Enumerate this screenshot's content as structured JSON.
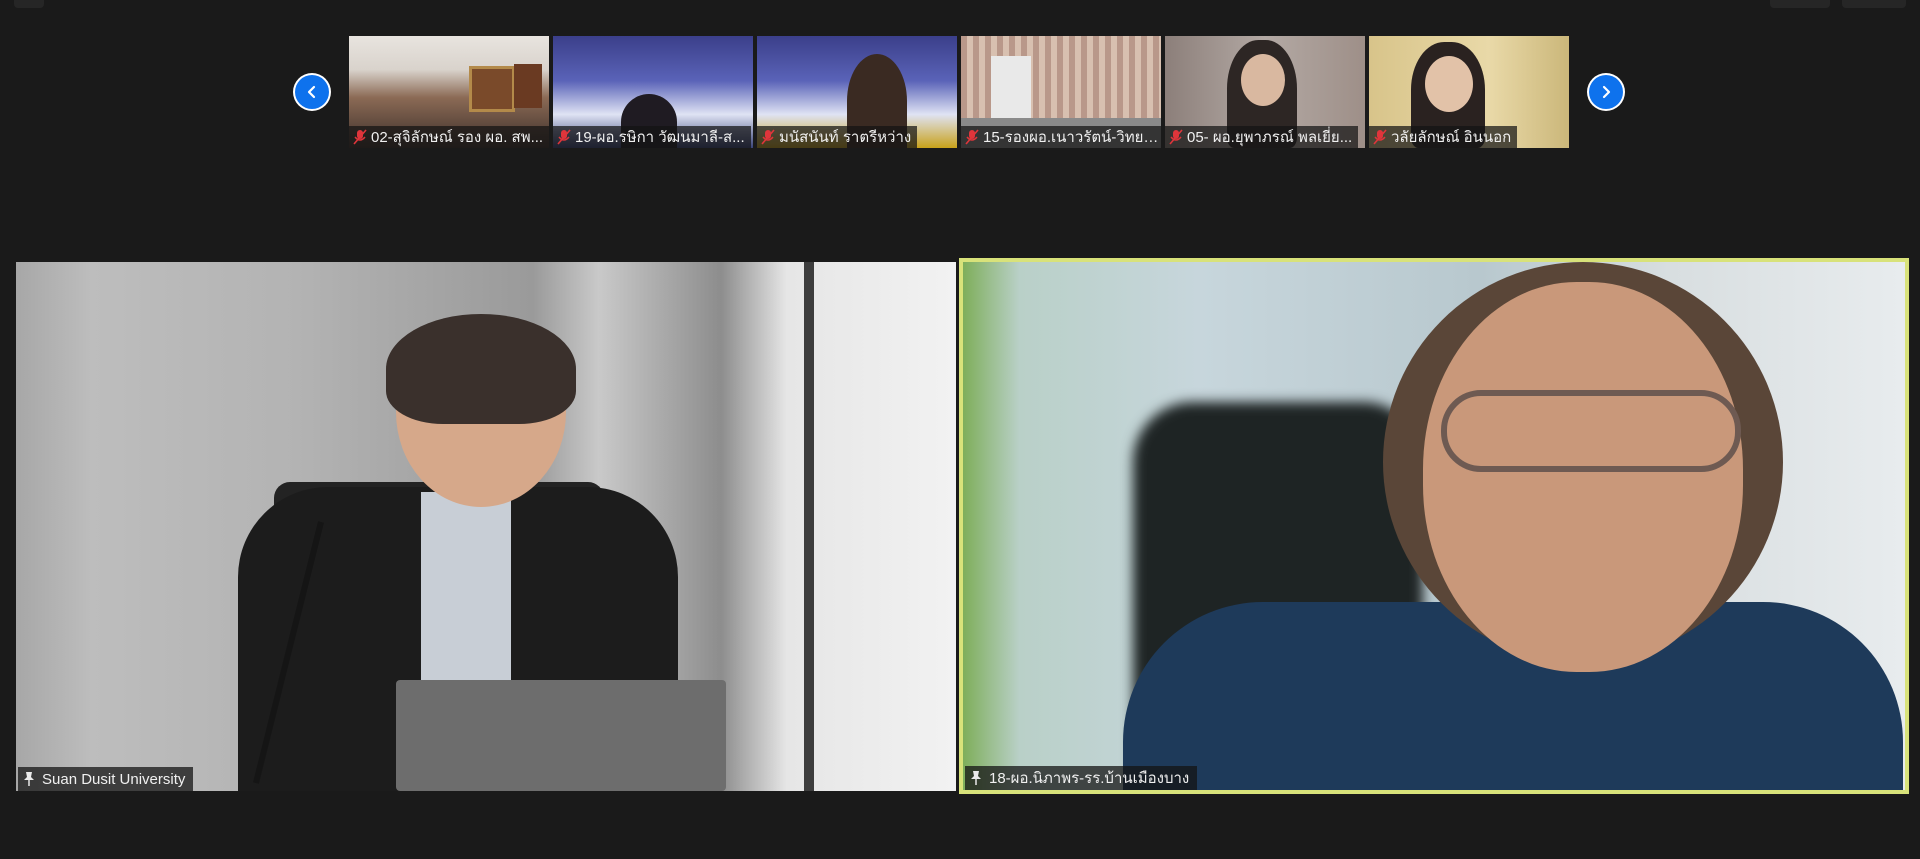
{
  "thumbnails": [
    {
      "label": "02-สุจิลักษณ์ รอง ผอ. สพ..."
    },
    {
      "label": "19-ผอ.รษิกา วัฒนมาลี-ส..."
    },
    {
      "label": "มนัสนันท์ ราตรีหว่าง"
    },
    {
      "label": "15-รองผอ.เนาวรัตน์-วิทยา..."
    },
    {
      "label": "05- ผอ.ยุพาภรณ์  พลเยี่ย..."
    },
    {
      "label": "วลัยลักษณ์ อินนอก"
    }
  ],
  "main_tiles": [
    {
      "label": "Suan Dusit University",
      "active_speaker": false
    },
    {
      "label": "18-ผอ.นิภาพร-รร.บ้านเมืองบาง",
      "active_speaker": true
    }
  ],
  "icons": {
    "muted": "mic-muted-icon",
    "pin": "pin-icon",
    "prev": "chevron-left-icon",
    "next": "chevron-right-icon"
  },
  "colors": {
    "background": "#1a1a1a",
    "active_speaker_border": "#d8e27a",
    "nav_button": "#0e72ed",
    "muted_icon": "#e0353b"
  }
}
